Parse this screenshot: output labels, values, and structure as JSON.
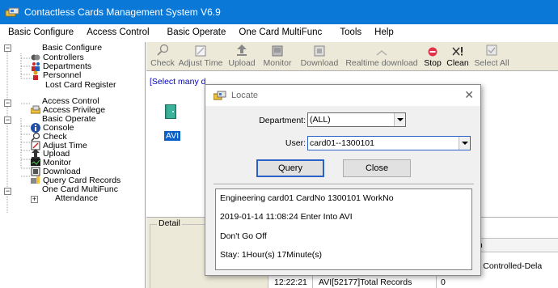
{
  "window": {
    "title": "Contactless Cards Management System  V6.9"
  },
  "menu": [
    "Basic Configure",
    "Access Control",
    "Basic Operate",
    "One Card MultiFunc",
    "Tools",
    "Help"
  ],
  "tree": {
    "basic_configure": "Basic Configure",
    "controllers": "Controllers",
    "departments": "Departments",
    "personnel": "Personnel",
    "lost_card_register": "Lost Card Register",
    "access_control": "Access Control",
    "access_privilege": "Access Privilege",
    "basic_operate": "Basic Operate",
    "console": "Console",
    "check": "Check",
    "adjust_time": "Adjust Time",
    "upload": "Upload",
    "monitor": "Monitor",
    "download": "Download",
    "query_card_records": "Query Card Records",
    "one_card_multifunc": "One Card MultiFunc",
    "attendance": "Attendance"
  },
  "toolbar": {
    "check": "Check",
    "adjust_time": "Adjust Time",
    "upload": "Upload",
    "monitor": "Monitor",
    "download": "Download",
    "realtime_download": "Realtime download",
    "stop": "Stop",
    "clean": "Clean",
    "select_all": "Select All"
  },
  "main": {
    "select_many": "[Select many d",
    "door_label": "AVI",
    "detail_label": "Detail",
    "col_partial": "on",
    "row_partial": "or Controlled-Dela",
    "row_time": "12:22:21",
    "row_text": "AVI[52177]Total Records",
    "row_value": "0"
  },
  "dialog": {
    "title": "Locate",
    "department_label": "Department:",
    "department_value": "(ALL)",
    "user_label": "User:",
    "user_value": "card01--1300101",
    "query_btn": "Query",
    "close_btn": "Close",
    "info": {
      "line1": "Engineering  card01  CardNo  1300101  WorkNo",
      "line2": "2019-01-14 11:08:24   Enter Into   AVI",
      "line3": "Don't Go Off",
      "line4": "Stay:  1Hour(s) 17Minute(s)"
    }
  },
  "colors": {
    "titlebar": "#0a78d7",
    "selection": "#0a5fc9",
    "link": "#0000c8",
    "stop_icon": "#e0334a"
  }
}
